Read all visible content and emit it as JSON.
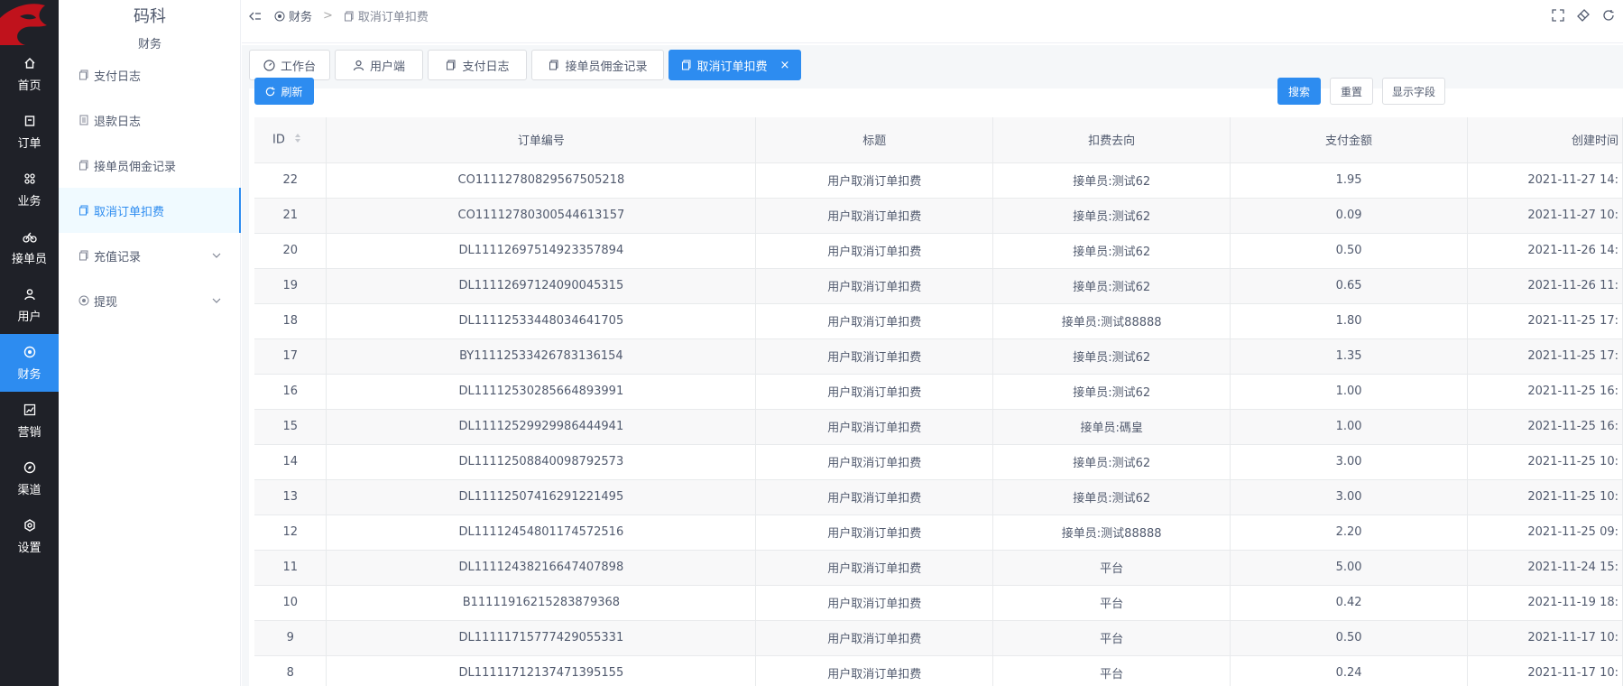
{
  "rail": {
    "items": [
      {
        "label": "首页",
        "icon": "home-icon"
      },
      {
        "label": "订单",
        "icon": "order-icon"
      },
      {
        "label": "业务",
        "icon": "grid-icon"
      },
      {
        "label": "接单员",
        "icon": "bicycle-icon"
      },
      {
        "label": "用户",
        "icon": "user-icon"
      },
      {
        "label": "财务",
        "icon": "finance-icon"
      },
      {
        "label": "营销",
        "icon": "chart-icon"
      },
      {
        "label": "渠道",
        "icon": "compass-icon"
      },
      {
        "label": "设置",
        "icon": "settings-icon"
      }
    ],
    "active_index": 5
  },
  "sidebar": {
    "brand": "码科",
    "section": "财务",
    "items": [
      {
        "label": "支付日志"
      },
      {
        "label": "退款日志"
      },
      {
        "label": "接单员佣金记录"
      },
      {
        "label": "取消订单扣费"
      },
      {
        "label": "充值记录"
      },
      {
        "label": "提现"
      }
    ],
    "active_index": 3
  },
  "breadcrumb": {
    "parent": "财务",
    "separator": ">",
    "current": "取消订单扣费"
  },
  "tabs": [
    {
      "label": "工作台"
    },
    {
      "label": "用户端"
    },
    {
      "label": "支付日志"
    },
    {
      "label": "接单员佣金记录"
    },
    {
      "label": "取消订单扣费",
      "close": "×"
    }
  ],
  "toolbar": {
    "refresh_label": "刷新",
    "search_label": "搜索",
    "reset_label": "重置",
    "fields_label": "显示字段"
  },
  "table": {
    "columns": [
      "ID",
      "订单编号",
      "标题",
      "扣费去向",
      "支付金额",
      "创建时间"
    ],
    "rows": [
      [
        "22",
        "CO11112780829567505218",
        "用户取消订单扣费",
        "接单员:测试62",
        "1.95",
        "2021-11-27 14:"
      ],
      [
        "21",
        "CO11112780300544613157",
        "用户取消订单扣费",
        "接单员:测试62",
        "0.09",
        "2021-11-27 10:"
      ],
      [
        "20",
        "DL11112697514923357894",
        "用户取消订单扣费",
        "接单员:测试62",
        "0.50",
        "2021-11-26 14:"
      ],
      [
        "19",
        "DL11112697124090045315",
        "用户取消订单扣费",
        "接单员:测试62",
        "0.65",
        "2021-11-26 11:"
      ],
      [
        "18",
        "DL11112533448034641705",
        "用户取消订单扣费",
        "接单员:测试88888",
        "1.80",
        "2021-11-25 17:"
      ],
      [
        "17",
        "BY11112533426783136154",
        "用户取消订单扣费",
        "接单员:测试62",
        "1.35",
        "2021-11-25 17:"
      ],
      [
        "16",
        "DL11112530285664893991",
        "用户取消订单扣费",
        "接单员:测试62",
        "1.00",
        "2021-11-25 16:"
      ],
      [
        "15",
        "DL11112529929986444941",
        "用户取消订单扣费",
        "接单员:碼皇",
        "1.00",
        "2021-11-25 16:"
      ],
      [
        "14",
        "DL11112508840098792573",
        "用户取消订单扣费",
        "接单员:测试62",
        "3.00",
        "2021-11-25 10:"
      ],
      [
        "13",
        "DL11112507416291221495",
        "用户取消订单扣费",
        "接单员:测试62",
        "3.00",
        "2021-11-25 10:"
      ],
      [
        "12",
        "DL11112454801174572516",
        "用户取消订单扣费",
        "接单员:测试88888",
        "2.20",
        "2021-11-25 09:"
      ],
      [
        "11",
        "DL11112438216647407898",
        "用户取消订单扣费",
        "平台",
        "5.00",
        "2021-11-24 15:"
      ],
      [
        "10",
        "B11111916215283879368",
        "用户取消订单扣费",
        "平台",
        "0.42",
        "2021-11-19 18:"
      ],
      [
        "9",
        "DL11111715777429055331",
        "用户取消订单扣费",
        "平台",
        "0.50",
        "2021-11-17 10:"
      ],
      [
        "8",
        "DL11111712137471395155",
        "用户取消订单扣费",
        "平台",
        "0.24",
        "2021-11-17 10:"
      ]
    ]
  },
  "colors": {
    "accent": "#2d8cf0",
    "rail_bg": "#1f2128",
    "logo_red": "#c0121c"
  }
}
